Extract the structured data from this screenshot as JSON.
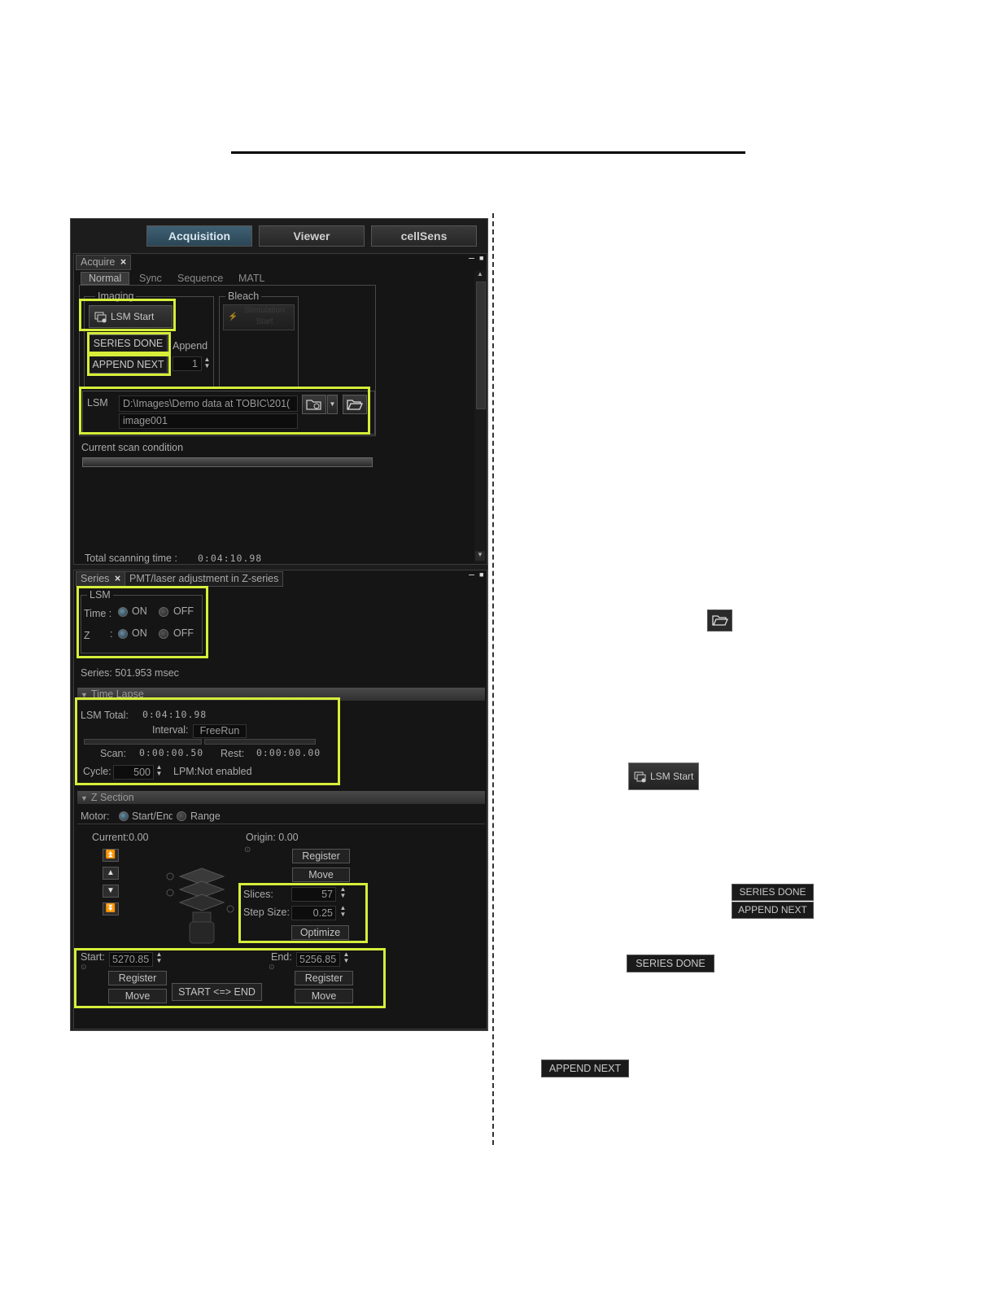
{
  "tabs": {
    "acquisition": "Acquisition",
    "viewer": "Viewer",
    "cellsens": "cellSens"
  },
  "acquire_panel": {
    "title": "Acquire",
    "subtabs": [
      "Normal",
      "Sync",
      "Sequence",
      "MATL"
    ],
    "imaging_label": "Imaging",
    "bleach_label": "Bleach",
    "lsm_start": "LSM Start",
    "stimulation_start": "Stimulation Start",
    "series_done": "SERIES DONE",
    "append_next": "APPEND NEXT",
    "append_label": "Append",
    "append_value": "1",
    "lsm_label": "LSM",
    "path_value": "D:\\Images\\Demo data at TOBIC\\201(",
    "filename_value": "image001",
    "current_scan_condition": "Current scan condition",
    "total_scanning_time_label": "Total scanning time :",
    "total_scanning_time_value": "0:04:10.98"
  },
  "series_panel": {
    "title": "Series",
    "tab2": "PMT/laser adjustment in Z-series",
    "lsm_label": "LSM",
    "time_label": "Time :",
    "z_label": "Z",
    "z_colon": ":",
    "on": "ON",
    "off": "OFF",
    "series_info": "Series: 501.953 msec",
    "time_lapse_header": "Time Lapse",
    "lsm_total_label": "LSM Total:",
    "lsm_total_value": "0:04:10.98",
    "interval_label": "Interval:",
    "interval_value": "FreeRun",
    "scan_label": "Scan:",
    "scan_value": "0:00:00.50",
    "rest_label": "Rest:",
    "rest_value": "0:00:00.00",
    "cycle_label": "Cycle:",
    "cycle_value": "500",
    "lpm_status": "LPM:Not enabled",
    "z_section_header": "Z Section",
    "motor_label": "Motor:",
    "start_end_option": "Start/End",
    "range_option": "Range",
    "current_label": "Current:0.00",
    "origin_label": "Origin: 0.00",
    "register": "Register",
    "move": "Move",
    "slices_label": "Slices:",
    "slices_value": "57",
    "step_size_label": "Step Size:",
    "step_size_value": "0.25",
    "optimize": "Optimize",
    "start_label": "Start:",
    "start_value": "5270.85",
    "end_label": "End:",
    "end_value": "5256.85",
    "swap_button": "START <=> END"
  },
  "right_column": {
    "lsm_start": "LSM Start",
    "series_done": "SERIES DONE",
    "append_next": "APPEND NEXT"
  },
  "colors": {
    "highlight": "#d6ee3a",
    "panel_bg": "#1c1c1c",
    "active_tab": "#3f6073"
  },
  "icons": [
    "folder-open-icon",
    "lsm-start-icon",
    "load-settings-icon",
    "stimulation-icon",
    "objective-stage-icon"
  ]
}
